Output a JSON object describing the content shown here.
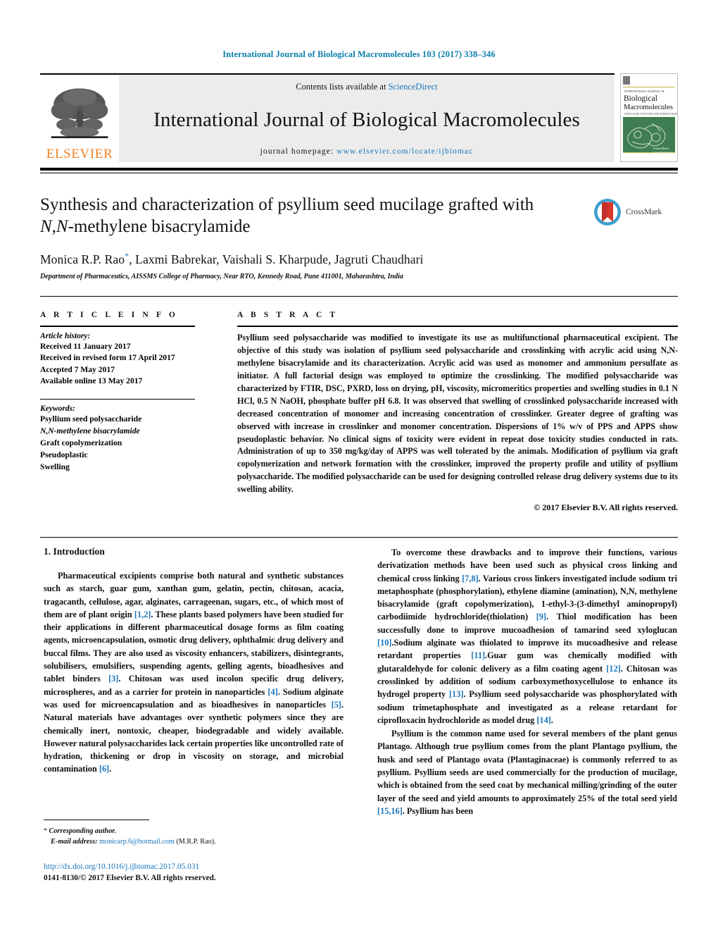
{
  "running_head": "International Journal of Biological Macromolecules 103 (2017) 338–346",
  "masthead": {
    "publisher_wordmark": "ELSEVIER",
    "contents_prefix": "Contents lists available at ",
    "contents_link": "ScienceDirect",
    "journal_title": "International Journal of Biological Macromolecules",
    "homepage_prefix": "journal homepage: ",
    "homepage_url": "www.elsevier.com/locate/ijbiomac",
    "cover": {
      "line1": "INTERNATIONAL JOURNAL OF",
      "line2": "Biological",
      "line3": "Macromolecules",
      "line4": "STRUCTURE, FUNCTION AND INTERACTIONS",
      "footer1": "ScienceDirect",
      "footer2": "www.sciencedirect.com"
    }
  },
  "article": {
    "title_line1": "Synthesis and characterization of psyllium seed mucilage grafted with",
    "title_italic": "N,N",
    "title_line2_rest": "-methylene bisacrylamide",
    "authors": "Monica R.P. Rao",
    "authors_rest": ", Laxmi Babrekar, Vaishali S. Kharpude, Jagruti Chaudhari",
    "corresponding_marker": "*",
    "affiliation": "Department of Pharmaceutics, AISSMS College of Pharmacy, Near RTO, Kennedy Road, Pune 411001, Maharashtra, India",
    "crossmark_label": "CrossMark"
  },
  "article_info": {
    "heading": "A R T I C L E   I N F O",
    "history_label": "Article history:",
    "history": [
      "Received 11 January 2017",
      "Received in revised form 17 April 2017",
      "Accepted 7 May 2017",
      "Available online 13 May 2017"
    ],
    "keywords_label": "Keywords:",
    "keywords": [
      "Psyllium seed polysaccharide",
      "N,N-methylene bisacrylamide",
      "Graft copolymerization",
      "Pseudoplastic",
      "Swelling"
    ]
  },
  "abstract": {
    "heading": "A B S T R A C T",
    "text": "Psyllium seed polysaccharide was modified to investigate its use as multifunctional pharmaceutical excipient. The objective of this study was isolation of psyllium seed polysaccharide and crosslinking with acrylic acid using N,N-methylene bisacrylamide and its characterization. Acrylic acid was used as monomer and ammonium persulfate as initiator. A full factorial design was employed to optimize the crosslinking. The modified polysaccharide was characterized by FTIR, DSC, PXRD, loss on drying, pH, viscosity, micromeritics properties and swelling studies in 0.1 N HCl, 0.5 N NaOH, phosphate buffer pH 6.8. It was observed that swelling of crosslinked polysaccharide increased with decreased concentration of monomer and increasing concentration of crosslinker. Greater degree of grafting was observed with increase in crosslinker and monomer concentration. Dispersions of 1% w/v of PPS and APPS show pseudoplastic behavior. No clinical signs of toxicity were evident in repeat dose toxicity studies conducted in rats. Administration of up to 350 mg/kg/day of APPS was well tolerated by the animals. Modification of psyllium via graft copolymerization and network formation with the crosslinker, improved the property profile and utility of psyllium polysaccharide. The modified polysaccharide can be used for designing controlled release drug delivery systems due to its swelling ability.",
    "copyright": "© 2017 Elsevier B.V. All rights reserved."
  },
  "introduction": {
    "section_title": "1.  Introduction",
    "left_paragraph": "Pharmaceutical excipients comprise both natural and synthetic substances such as starch, guar gum, xanthan gum, gelatin, pectin, chitosan, acacia, tragacanth, cellulose, agar, alginates, carrageenan, sugars, etc., of which most of them are of plant origin [1,2]. These plants based polymers have been studied for their applications in different pharmaceutical dosage forms as film coating agents, microencapsulation, osmotic drug delivery, ophthalmic drug delivery and buccal films. They are also used as viscosity enhancers, stabilizers, disintegrants, solubilisers, emulsifiers, suspending agents, gelling agents, bioadhesives and tablet binders [3]. Chitosan was used incolon specific drug delivery, microspheres, and as a carrier for protein in nanoparticles [4]. Sodium alginate was used for microencapsulation and as bioadhesives in nanoparticles [5]. Natural materials have advantages over synthetic polymers since they are chemically inert, nontoxic, cheaper, biodegradable and widely available. However natural polysaccharides lack certain properties like uncontrolled rate of hydration, thickening or drop in viscosity on storage, and microbial contamination [6].",
    "right_paragraph_1": "To overcome these drawbacks and to improve their functions, various derivatization methods have been used such as physical cross linking and chemical cross linking [7,8]. Various cross linkers investigated include sodium tri metaphosphate (phosphorylation), ethylene diamine (amination), N,N, methylene bisacrylamide (graft copolymerization), 1-ethyl-3-(3-dimethyl aminopropyl) carbodiimide hydrochloride(thiolation) [9]. Thiol modification has been successfully done to improve mucoadhesion of tamarind seed xyloglucan [10].Sodium alginate was thiolated to improve its mucoadhesive and release retardant properties [11].Guar gum was chemically modified with glutaraldehyde for colonic delivery as a film coating agent [12]. Chitosan was crosslinked by addition of sodium carboxymethoxycellulose to enhance its hydrogel property [13]. Psyllium seed polysaccharide was phosphorylated with sodium trimetaphosphate and investigated as a release retardant for ciprofloxacin hydrochloride as model drug [14].",
    "right_paragraph_2": "Psyllium is the common name used for several members of the plant genus Plantago. Although true psyllium comes from the plant Plantago psyllium, the husk and seed of Plantago ovata (Plantaginaceae) is commonly referred to as psyllium. Psyllium seeds are used commercially for the production of mucilage, which is obtained from the seed coat by mechanical milling/grinding of the outer layer of the seed and yield amounts to approximately 25% of the total seed yield [15,16]. Psyllium has been"
  },
  "footer": {
    "corresponding_marker": "*",
    "corresponding_label": "Corresponding author.",
    "email_label": "E-mail address:",
    "email": "monicarp.6@hotmail.com",
    "email_suffix": "(M.R.P. Rao).",
    "doi": "http://dx.doi.org/10.1016/j.ijbiomac.2017.05.031",
    "issn_line": "0141-8130/© 2017 Elsevier B.V. All rights reserved."
  },
  "colors": {
    "link_blue": "#1a75bb",
    "runhead_blue": "#0b7fab",
    "elsevier_orange": "#f08222",
    "banner_grey": "#ececec",
    "cover_green": "#3f7d52"
  }
}
